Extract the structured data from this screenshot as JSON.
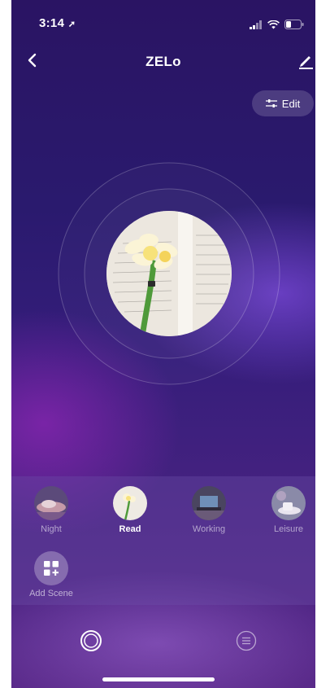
{
  "status_bar": {
    "time": "3:14"
  },
  "header": {
    "title": "ZELo"
  },
  "edit_button": {
    "label": "Edit"
  },
  "scenes": [
    {
      "label": "Night",
      "active": false
    },
    {
      "label": "Read",
      "active": true
    },
    {
      "label": "Working",
      "active": false
    },
    {
      "label": "Leisure",
      "active": false
    }
  ],
  "add_scene": {
    "label": "Add Scene"
  },
  "colors": {
    "background_top": "#2a1463",
    "background_bottom": "#5a2a8a",
    "flower": "#f7e27a",
    "stem": "#4f9a3a"
  }
}
